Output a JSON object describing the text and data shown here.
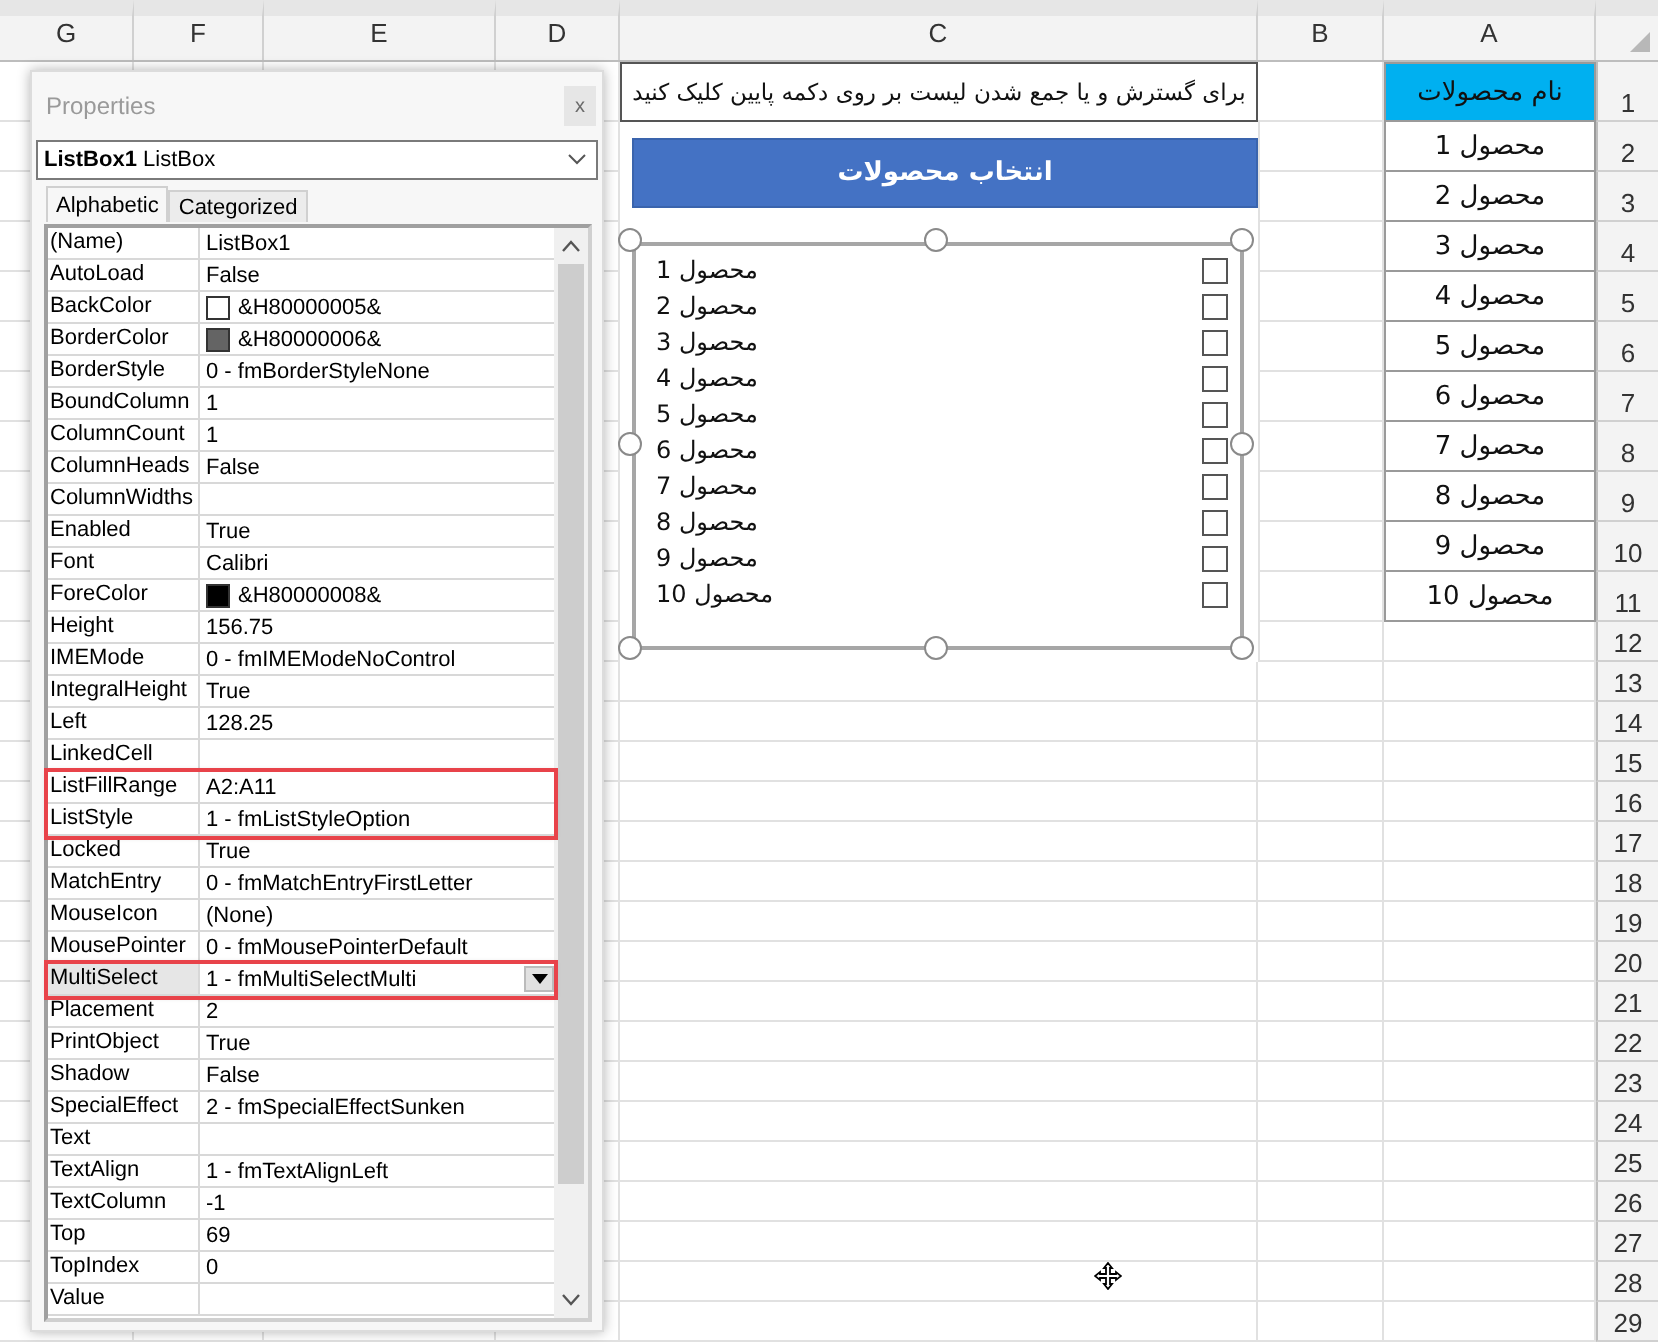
{
  "sheet": {
    "columns": [
      "G",
      "F",
      "E",
      "D",
      "C",
      "B",
      "A"
    ],
    "row_numbers": [
      "1",
      "2",
      "3",
      "4",
      "5",
      "6",
      "7",
      "8",
      "9",
      "10",
      "11",
      "12",
      "13",
      "14",
      "15",
      "16",
      "17",
      "18",
      "19",
      "20",
      "21",
      "22",
      "23",
      "24",
      "25",
      "26",
      "27",
      "28",
      "29"
    ],
    "instruction": "برای گسترش و یا جمع شدن لیست بر روی دکمه پایین کلیک کنید",
    "column_a_header": "نام محصولات",
    "column_a_cells": [
      "محصول 1",
      "محصول 2",
      "محصول 3",
      "محصول 4",
      "محصول 5",
      "محصول 6",
      "محصول 7",
      "محصول 8",
      "محصول 9",
      "محصول 10"
    ]
  },
  "button": {
    "label": "انتخاب محصولات"
  },
  "listbox": {
    "items": [
      {
        "label": "محصول 1",
        "checked": false
      },
      {
        "label": "محصول 2",
        "checked": false
      },
      {
        "label": "محصول 3",
        "checked": false
      },
      {
        "label": "محصول 4",
        "checked": false
      },
      {
        "label": "محصول 5",
        "checked": false
      },
      {
        "label": "محصول 6",
        "checked": false
      },
      {
        "label": "محصول 7",
        "checked": false
      },
      {
        "label": "محصول 8",
        "checked": false
      },
      {
        "label": "محصول 9",
        "checked": false
      },
      {
        "label": "محصول 10",
        "checked": false
      }
    ]
  },
  "properties": {
    "title": "Properties",
    "close": "x",
    "object_selector": "**ListBox1** ListBox",
    "tabs": [
      {
        "label": "Alphabetic",
        "selected": true
      },
      {
        "label": "Categorized",
        "selected": false
      }
    ],
    "rows": [
      {
        "name": "(Name)",
        "value": "ListBox1",
        "kind": "text",
        "selected": false,
        "highlighted": false
      },
      {
        "name": "AutoLoad",
        "value": "False",
        "kind": "text",
        "selected": false,
        "highlighted": false
      },
      {
        "name": "BackColor",
        "value": "&H80000005&",
        "kind": "color",
        "color": "#ffffff",
        "selected": false,
        "highlighted": false
      },
      {
        "name": "BorderColor",
        "value": "&H80000006&",
        "kind": "color",
        "color": "#646464",
        "selected": false,
        "highlighted": false
      },
      {
        "name": "BorderStyle",
        "value": "0 - fmBorderStyleNone",
        "kind": "text",
        "selected": false,
        "highlighted": false
      },
      {
        "name": "BoundColumn",
        "value": "1",
        "kind": "text",
        "selected": false,
        "highlighted": false
      },
      {
        "name": "ColumnCount",
        "value": "1",
        "kind": "text",
        "selected": false,
        "highlighted": false
      },
      {
        "name": "ColumnHeads",
        "value": "False",
        "kind": "text",
        "selected": false,
        "highlighted": false
      },
      {
        "name": "ColumnWidths",
        "kind": "text",
        "selected": false,
        "highlighted": false
      },
      {
        "name": "Enabled",
        "value": "True",
        "kind": "text",
        "selected": false,
        "highlighted": false
      },
      {
        "name": "Font",
        "value": "Calibri",
        "kind": "text",
        "selected": false,
        "highlighted": false
      },
      {
        "name": "ForeColor",
        "value": "&H80000008&",
        "kind": "color",
        "color": "#000000",
        "selected": false,
        "highlighted": false
      },
      {
        "name": "Height",
        "value": "156.75",
        "kind": "text",
        "selected": false,
        "highlighted": false
      },
      {
        "name": "IMEMode",
        "value": "0 - fmIMEModeNoControl",
        "kind": "text",
        "selected": false,
        "highlighted": false
      },
      {
        "name": "IntegralHeight",
        "value": "True",
        "kind": "text",
        "selected": false,
        "highlighted": false
      },
      {
        "name": "Left",
        "value": "128.25",
        "kind": "text",
        "selected": false,
        "highlighted": false
      },
      {
        "name": "LinkedCell",
        "kind": "text",
        "selected": false,
        "highlighted": false
      },
      {
        "name": "ListFillRange",
        "value": "A2:A11",
        "kind": "text",
        "selected": false,
        "highlighted": true
      },
      {
        "name": "ListStyle",
        "value": "1 - fmListStyleOption",
        "kind": "text",
        "selected": false,
        "highlighted": true
      },
      {
        "name": "Locked",
        "value": "True",
        "kind": "text",
        "selected": false,
        "highlighted": false
      },
      {
        "name": "MatchEntry",
        "value": "0 - fmMatchEntryFirstLetter",
        "kind": "text",
        "selected": false,
        "highlighted": false
      },
      {
        "name": "MouseIcon",
        "value": "(None)",
        "kind": "text",
        "selected": false,
        "highlighted": false
      },
      {
        "name": "MousePointer",
        "value": "0 - fmMousePointerDefault",
        "kind": "text",
        "selected": false,
        "highlighted": false
      },
      {
        "name": "MultiSelect",
        "value": "1 - fmMultiSelectMulti",
        "kind": "dropdown",
        "selected": true,
        "highlighted": true
      },
      {
        "name": "Placement",
        "value": "2",
        "kind": "text",
        "selected": false,
        "highlighted": false
      },
      {
        "name": "PrintObject",
        "value": "True",
        "kind": "text",
        "selected": false,
        "highlighted": false
      },
      {
        "name": "Shadow",
        "value": "False",
        "kind": "text",
        "selected": false,
        "highlighted": false
      },
      {
        "name": "SpecialEffect",
        "value": "2 - fmSpecialEffectSunken",
        "kind": "text",
        "selected": false,
        "highlighted": false
      },
      {
        "name": "Text",
        "kind": "text",
        "selected": false,
        "highlighted": false
      },
      {
        "name": "TextAlign",
        "value": "1 - fmTextAlignLeft",
        "kind": "text",
        "selected": false,
        "highlighted": false
      },
      {
        "name": "TextColumn",
        "value": "-1",
        "kind": "text",
        "selected": false,
        "highlighted": false
      },
      {
        "name": "Top",
        "value": "69",
        "kind": "text",
        "selected": false,
        "highlighted": false
      },
      {
        "name": "TopIndex",
        "value": "0",
        "kind": "text",
        "selected": false,
        "highlighted": false
      },
      {
        "name": "Value",
        "kind": "text",
        "selected": false,
        "highlighted": false
      }
    ]
  }
}
